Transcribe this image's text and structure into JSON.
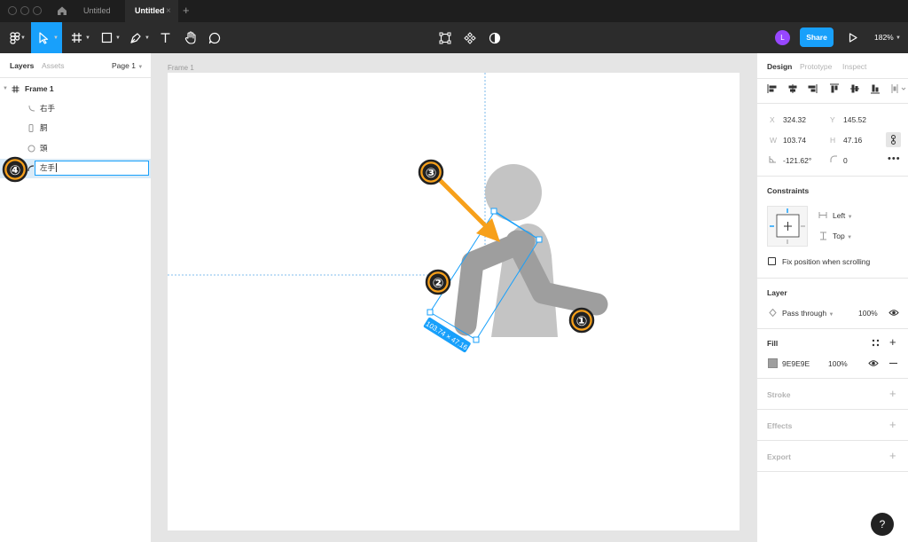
{
  "titlebar": {
    "tabs": [
      {
        "label": "Untitled",
        "active": false
      },
      {
        "label": "Untitled",
        "active": true
      }
    ],
    "close_glyph": "×",
    "add_glyph": "+"
  },
  "toolbar": {
    "tools": [
      "main-menu-icon",
      "move-icon",
      "frame-icon",
      "shape-icon",
      "pen-icon",
      "text-icon",
      "hand-icon",
      "comment-icon"
    ],
    "center_tools": [
      "edit-object-icon",
      "component-icon",
      "mask-icon"
    ],
    "avatar_initial": "L",
    "share_label": "Share",
    "zoom_label": "182%",
    "accent": "#18a0fb"
  },
  "left_panel": {
    "tabs": {
      "layers": "Layers",
      "assets": "Assets",
      "page": "Page 1"
    },
    "layers": [
      {
        "name": "Frame 1",
        "icon": "frame-icon"
      },
      {
        "name": "右手",
        "icon": "vector-icon"
      },
      {
        "name": "胴",
        "icon": "rectangle-icon"
      },
      {
        "name": "頭",
        "icon": "ellipse-icon"
      }
    ],
    "rename_value": "左手"
  },
  "canvas": {
    "frame_label": "Frame 1",
    "size_badge": "103.74 × 47.16",
    "annotations": [
      "①",
      "②",
      "③",
      "④"
    ],
    "fill_color": "#9e9e9e",
    "body_color": "#c4c4c4"
  },
  "right_panel": {
    "tabs": {
      "design": "Design",
      "prototype": "Prototype",
      "inspect": "Inspect"
    },
    "x_key": "X",
    "x_value": "324.32",
    "y_key": "Y",
    "y_value": "145.52",
    "w_key": "W",
    "w_value": "103.74",
    "h_key": "H",
    "h_value": "47.16",
    "rotation_value": "-121.62°",
    "radius_value": "0",
    "constraints_title": "Constraints",
    "constraint_h": "Left",
    "constraint_v": "Top",
    "fix_scroll_label": "Fix position when scrolling",
    "layer_title": "Layer",
    "blend_mode": "Pass through",
    "layer_opacity": "100%",
    "fill_title": "Fill",
    "fill_hex": "9E9E9E",
    "fill_opacity": "100%",
    "stroke_title": "Stroke",
    "effects_title": "Effects",
    "export_title": "Export",
    "help_glyph": "?"
  }
}
